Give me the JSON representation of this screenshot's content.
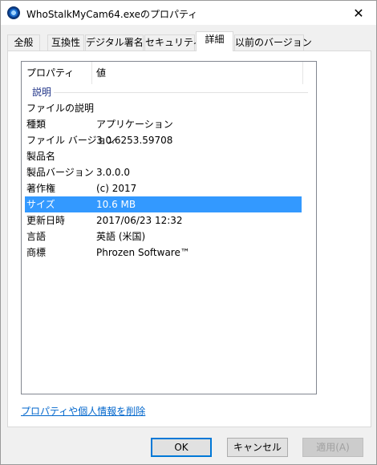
{
  "window": {
    "title": "WhoStalkMyCam64.exeのプロパティ",
    "close_symbol": "✕",
    "app_icon": "camera-app-icon"
  },
  "tabs": [
    {
      "label": "全般"
    },
    {
      "label": "互換性"
    },
    {
      "label": "デジタル署名"
    },
    {
      "label": "セキュリティ"
    },
    {
      "label": "詳細",
      "active": true
    },
    {
      "label": "以前のバージョン"
    }
  ],
  "details": {
    "columns": {
      "property": "プロパティ",
      "value": "値"
    },
    "group": "説明",
    "rows": [
      {
        "name": "ファイルの説明",
        "value": ""
      },
      {
        "name": "種類",
        "value": "アプリケーション"
      },
      {
        "name": "ファイル バージョン",
        "value": "3.0.6253.59708"
      },
      {
        "name": "製品名",
        "value": ""
      },
      {
        "name": "製品バージョン",
        "value": "3.0.0.0"
      },
      {
        "name": "著作権",
        "value": "(c) 2017"
      },
      {
        "name": "サイズ",
        "value": "10.6 MB",
        "selected": true
      },
      {
        "name": "更新日時",
        "value": "2017/06/23 12:32"
      },
      {
        "name": "言語",
        "value": "英語 (米国)"
      },
      {
        "name": "商標",
        "value": "Phrozen Software™"
      }
    ]
  },
  "remove_link": "プロパティや個人情報を削除",
  "buttons": {
    "ok": "OK",
    "cancel": "キャンセル",
    "apply": "適用(A)"
  },
  "colors": {
    "selection": "#3399ff",
    "link": "#0066cc",
    "default_button_border": "#0078d7"
  }
}
